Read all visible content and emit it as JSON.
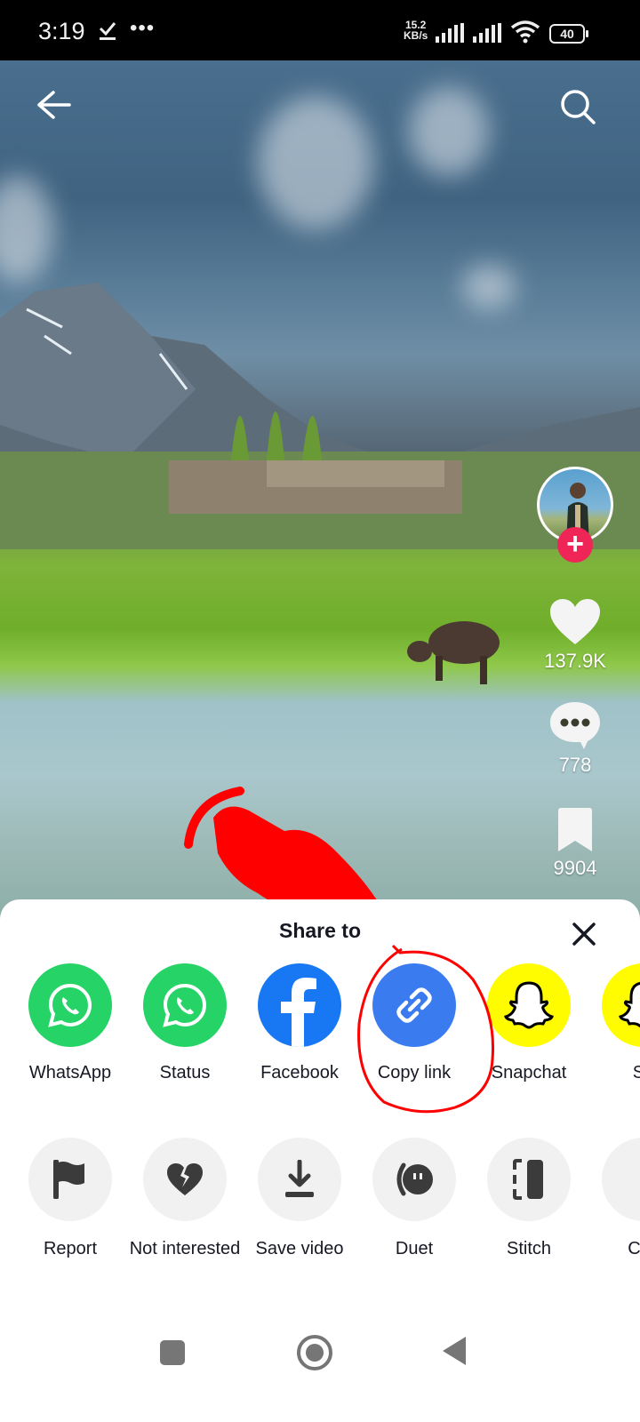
{
  "status_bar": {
    "time": "3:19",
    "network_speed_value": "15.2",
    "network_speed_unit": "KB/s",
    "battery": "40"
  },
  "video": {
    "likes": "137.9K",
    "comments": "778",
    "bookmarks": "9904"
  },
  "share_sheet": {
    "title": "Share to",
    "share_targets": [
      {
        "label": "WhatsApp",
        "icon": "whatsapp-icon",
        "color": "#25d366"
      },
      {
        "label": "Status",
        "icon": "whatsapp-status-icon",
        "color": "#25d366"
      },
      {
        "label": "Facebook",
        "icon": "facebook-icon",
        "color": "#1877f2"
      },
      {
        "label": "Copy link",
        "icon": "link-icon",
        "color": "#3a7cf0"
      },
      {
        "label": "Snapchat",
        "icon": "snapchat-icon",
        "color": "#fffc00"
      },
      {
        "label": "Sn",
        "icon": "snapchat-icon",
        "color": "#fffc00"
      }
    ],
    "actions": [
      {
        "label": "Report",
        "icon": "flag-icon"
      },
      {
        "label": "Not interested",
        "icon": "broken-heart-icon"
      },
      {
        "label": "Save video",
        "icon": "download-icon"
      },
      {
        "label": "Duet",
        "icon": "duet-icon"
      },
      {
        "label": "Stitch",
        "icon": "stitch-icon"
      },
      {
        "label": "C st",
        "icon": "sticker-icon"
      }
    ]
  },
  "colors": {
    "follow_accent": "#ee2556",
    "annotation_red": "#ff0000"
  }
}
